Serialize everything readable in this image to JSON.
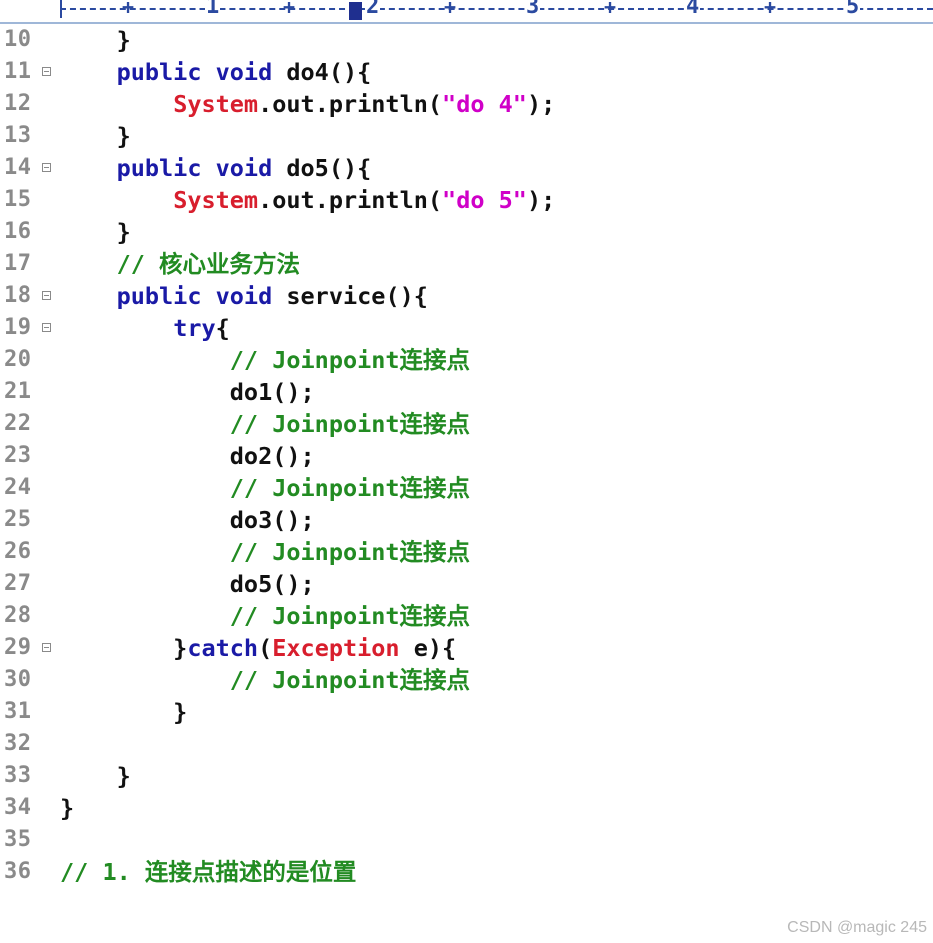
{
  "ruler": {
    "labels": [
      "1",
      "2",
      "3",
      "4",
      "5"
    ]
  },
  "lines": [
    {
      "n": "10",
      "code": "    }"
    },
    {
      "n": "11",
      "code": "    public void do4(){"
    },
    {
      "n": "12",
      "code": "        System.out.println(\"do 4\");"
    },
    {
      "n": "13",
      "code": "    }"
    },
    {
      "n": "14",
      "code": "    public void do5(){"
    },
    {
      "n": "15",
      "code": "        System.out.println(\"do 5\");"
    },
    {
      "n": "16",
      "code": "    }"
    },
    {
      "n": "17",
      "code": "    // 核心业务方法"
    },
    {
      "n": "18",
      "code": "    public void service(){"
    },
    {
      "n": "19",
      "code": "        try{"
    },
    {
      "n": "20",
      "code": "            // Joinpoint连接点"
    },
    {
      "n": "21",
      "code": "            do1();"
    },
    {
      "n": "22",
      "code": "            // Joinpoint连接点"
    },
    {
      "n": "23",
      "code": "            do2();"
    },
    {
      "n": "24",
      "code": "            // Joinpoint连接点"
    },
    {
      "n": "25",
      "code": "            do3();"
    },
    {
      "n": "26",
      "code": "            // Joinpoint连接点"
    },
    {
      "n": "27",
      "code": "            do5();"
    },
    {
      "n": "28",
      "code": "            // Joinpoint连接点"
    },
    {
      "n": "29",
      "code": "        }catch(Exception e){"
    },
    {
      "n": "30",
      "code": "            // Joinpoint连接点"
    },
    {
      "n": "31",
      "code": "        }"
    },
    {
      "n": "32",
      "code": ""
    },
    {
      "n": "33",
      "code": "    }"
    },
    {
      "n": "34",
      "code": "}"
    },
    {
      "n": "35",
      "code": ""
    },
    {
      "n": "36",
      "code": "// 1. 连接点描述的是位置"
    }
  ],
  "watermark": "CSDN @magic 245",
  "colors": {
    "keyword": "#1a1aa6",
    "class": "#d81e2d",
    "string": "#d000c8",
    "comment": "#228b22",
    "text": "#111111",
    "line_number": "#8a8a8a"
  }
}
